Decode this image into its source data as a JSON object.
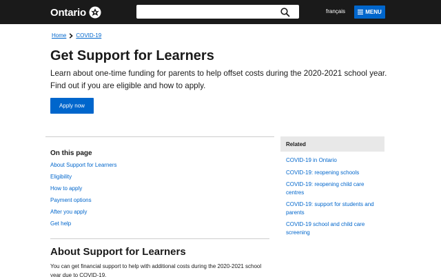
{
  "header": {
    "logo_text": "Ontario",
    "search": {
      "value": "",
      "placeholder": ""
    },
    "lang_link": "français",
    "menu_label": "MENU"
  },
  "breadcrumb": {
    "items": [
      "Home",
      "COVID-19"
    ]
  },
  "main": {
    "title": "Get Support for Learners",
    "intro": "Learn about one-time funding for parents to help offset costs during the 2020-2021 school year. Find out if you are eligible and how to apply.",
    "apply_button": "Apply now"
  },
  "on_this_page": {
    "heading": "On this page",
    "items": [
      "About Support for Learners",
      "Eligibility",
      "How to apply",
      "Payment options",
      "After you apply",
      "Get help"
    ]
  },
  "related": {
    "heading": "Related",
    "items": [
      "COVID-19 in Ontario",
      "COVID-19: reopening schools",
      "COVID-19: reopening child care centres",
      "COVID-19: support for students and parents",
      "COVID-19 school and child care screening"
    ]
  },
  "section": {
    "title": "About Support for Learners",
    "body": "You can get financial support to help with additional costs during the 2020-2021 school year due to COVID-19."
  },
  "colors": {
    "header_bg": "#1a1a1a",
    "link": "#0066cc",
    "button": "#0066cc",
    "related_header_bg": "#e8e8e8"
  },
  "icons": [
    "ontario-trillium-logo-icon",
    "search-icon",
    "menu-hamburger-icon",
    "chevron-right-icon"
  ]
}
